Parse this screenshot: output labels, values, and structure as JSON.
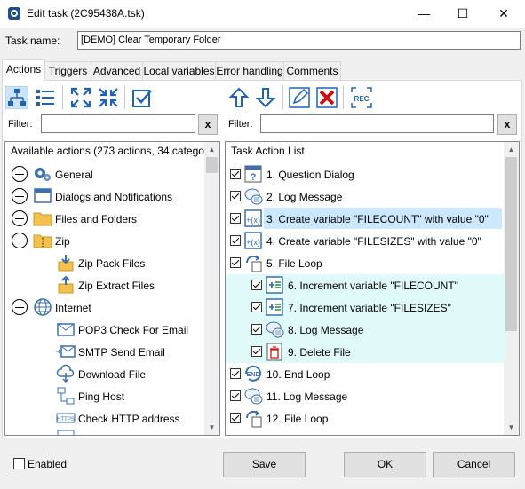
{
  "window": {
    "title": "Edit task (2C95438A.tsk)",
    "min": "—",
    "max": "☐",
    "close": "✕"
  },
  "task_name": {
    "label": "Task name:",
    "value": "[DEMO] Clear Temporary Folder"
  },
  "tabs": [
    "Actions",
    "Triggers",
    "Advanced",
    "Local variables",
    "Error handling",
    "Comments"
  ],
  "left": {
    "filter_label": "Filter:",
    "clear": "x",
    "header": "Available actions (273 actions, 34 catego...",
    "items": [
      {
        "label": "General",
        "icon": "gears-icon"
      },
      {
        "label": "Dialogs and Notifications",
        "icon": "window-icon"
      },
      {
        "label": "Files and Folders",
        "icon": "folder-icon"
      },
      {
        "label": "Zip",
        "icon": "zip-folder-icon"
      },
      {
        "label": "Zip Pack Files",
        "icon": "zip-pack-icon"
      },
      {
        "label": "Zip Extract Files",
        "icon": "zip-extract-icon"
      },
      {
        "label": "Internet",
        "icon": "globe-icon"
      },
      {
        "label": "POP3 Check For Email",
        "icon": "email-check-icon"
      },
      {
        "label": "SMTP Send Email",
        "icon": "email-send-icon"
      },
      {
        "label": "Download File",
        "icon": "cloud-download-icon"
      },
      {
        "label": "Ping Host",
        "icon": "network-icon"
      },
      {
        "label": "Check HTTP address",
        "icon": "https-icon"
      }
    ]
  },
  "right": {
    "filter_label": "Filter:",
    "clear": "x",
    "header": "Task Action List",
    "items": [
      {
        "label": "1. Question Dialog"
      },
      {
        "label": "2. Log Message"
      },
      {
        "label": "3. Create variable \"FILECOUNT\" with value \"0\""
      },
      {
        "label": "4. Create variable \"FILESIZES\" with value \"0\""
      },
      {
        "label": "5. File Loop"
      },
      {
        "label": "6. Increment variable \"FILECOUNT\""
      },
      {
        "label": "7. Increment variable \"FILESIZES\""
      },
      {
        "label": "8. Log Message"
      },
      {
        "label": "9. Delete File"
      },
      {
        "label": "10. End Loop"
      },
      {
        "label": "11. Log Message"
      },
      {
        "label": "12. File Loop"
      }
    ]
  },
  "bottom": {
    "enabled": "Enabled",
    "save": "Save",
    "ok": "OK",
    "cancel": "Cancel"
  },
  "colors": {
    "selected": "#cce8ff",
    "nested": "#e0fafa",
    "accent": "#1e63b6"
  }
}
